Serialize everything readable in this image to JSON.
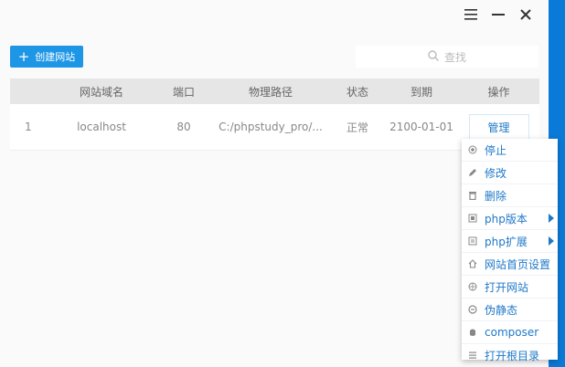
{
  "window": {
    "minimize_label": "—",
    "close_label": "✕"
  },
  "toolbar": {
    "create_label": "创建网站",
    "search_placeholder": "查找"
  },
  "table": {
    "headers": [
      "",
      "网站域名",
      "端口",
      "物理路径",
      "状态",
      "到期",
      "操作"
    ],
    "rows": [
      {
        "index": "1",
        "domain": "localhost",
        "port": "80",
        "path": "C:/phpstudy_pro/...",
        "status": "正常",
        "expiry": "2100-01-01",
        "action": "管理"
      }
    ]
  },
  "menu": {
    "items": [
      {
        "label": "停止",
        "icon": "stop-icon"
      },
      {
        "label": "修改",
        "icon": "edit-icon"
      },
      {
        "label": "删除",
        "icon": "trash-icon"
      },
      {
        "label": "php版本",
        "icon": "php-version-icon",
        "submenu": true
      },
      {
        "label": "php扩展",
        "icon": "php-extension-icon",
        "submenu": true
      },
      {
        "label": "网站首页设置",
        "icon": "home-icon"
      },
      {
        "label": "打开网站",
        "icon": "globe-icon"
      },
      {
        "label": "伪静态",
        "icon": "rewrite-icon"
      },
      {
        "label": "composer",
        "icon": "composer-icon"
      },
      {
        "label": "打开根目录",
        "icon": "list-icon"
      }
    ]
  },
  "colors": {
    "accent": "#1e96e6",
    "link": "#1e78c8",
    "brand_strip": "#0a7ad8"
  }
}
